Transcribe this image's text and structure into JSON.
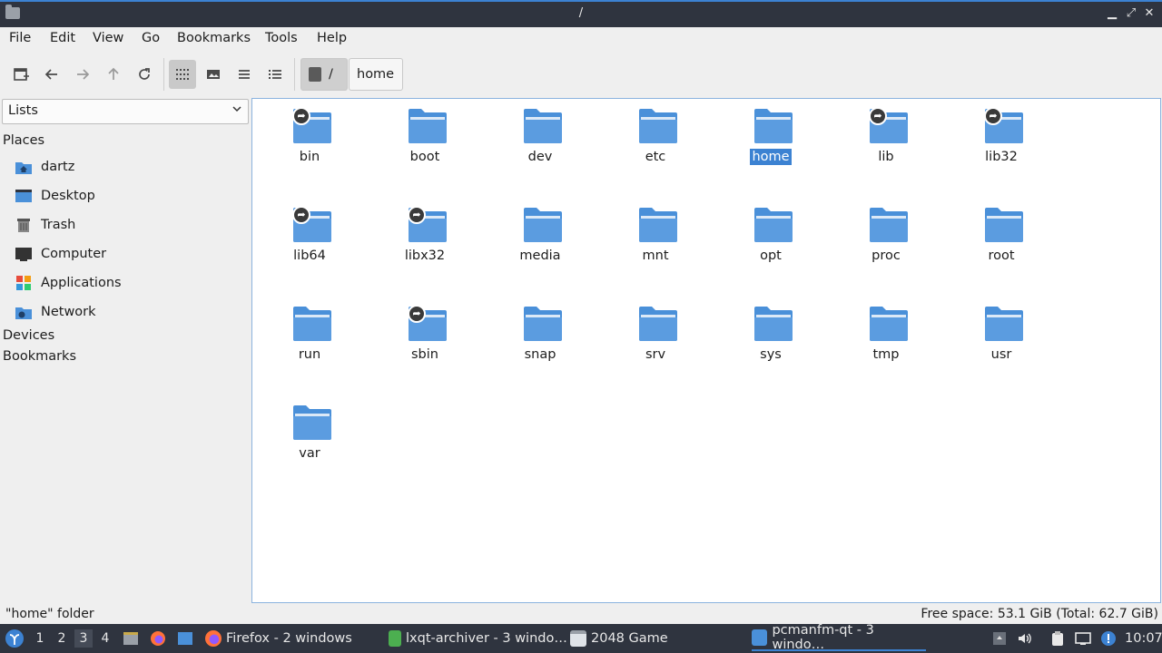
{
  "window": {
    "title": "/",
    "minimize_icon": "minimize-icon",
    "restore_icon": "restore-icon",
    "close_icon": "close-icon"
  },
  "menu": [
    "File",
    "Edit",
    "View",
    "Go",
    "Bookmarks",
    "Tools",
    "Help"
  ],
  "toolbar": {
    "buttons": [
      "new-tab-icon",
      "back-icon",
      "forward-icon",
      "up-icon",
      "reload-icon",
      "icon-view-icon",
      "thumbnail-view-icon",
      "compact-view-icon",
      "detailed-list-icon"
    ],
    "path_root": "/",
    "path_crumb": "home"
  },
  "sidebar": {
    "selector": "Lists",
    "places_heading": "Places",
    "places": [
      {
        "label": "dartz",
        "icon": "home-folder-icon"
      },
      {
        "label": "Desktop",
        "icon": "desktop-icon"
      },
      {
        "label": "Trash",
        "icon": "trash-icon"
      },
      {
        "label": "Computer",
        "icon": "computer-icon"
      },
      {
        "label": "Applications",
        "icon": "applications-icon"
      },
      {
        "label": "Network",
        "icon": "network-icon"
      }
    ],
    "devices_heading": "Devices",
    "bookmarks_heading": "Bookmarks"
  },
  "folders": [
    {
      "name": "bin",
      "link": true
    },
    {
      "name": "boot",
      "link": false
    },
    {
      "name": "dev",
      "link": false
    },
    {
      "name": "etc",
      "link": false
    },
    {
      "name": "home",
      "link": false,
      "selected": true
    },
    {
      "name": "lib",
      "link": true
    },
    {
      "name": "lib32",
      "link": true
    },
    {
      "name": "lib64",
      "link": true
    },
    {
      "name": "libx32",
      "link": true
    },
    {
      "name": "media",
      "link": false
    },
    {
      "name": "mnt",
      "link": false
    },
    {
      "name": "opt",
      "link": false
    },
    {
      "name": "proc",
      "link": false
    },
    {
      "name": "root",
      "link": false
    },
    {
      "name": "run",
      "link": false
    },
    {
      "name": "sbin",
      "link": true
    },
    {
      "name": "snap",
      "link": false
    },
    {
      "name": "srv",
      "link": false
    },
    {
      "name": "sys",
      "link": false
    },
    {
      "name": "tmp",
      "link": false
    },
    {
      "name": "usr",
      "link": false
    },
    {
      "name": "var",
      "link": false
    }
  ],
  "status": {
    "left": "\"home\" folder",
    "right": "Free space: 53.1 GiB (Total: 62.7 GiB)"
  },
  "taskbar": {
    "workspaces": [
      "1",
      "2",
      "3",
      "4"
    ],
    "active_workspace": "3",
    "tasks": [
      {
        "label": "Firefox - 2 windows",
        "icon": "firefox-icon"
      },
      {
        "label": "lxqt-archiver - 3 windo…",
        "icon": "archiver-icon"
      },
      {
        "label": "2048 Game",
        "icon": "window-icon"
      },
      {
        "label": "pcmanfm-qt - 3 windo…",
        "icon": "folder-icon"
      }
    ],
    "clock": "10:07"
  },
  "colors": {
    "accent": "#3c82d2",
    "folder": "#4a90d9",
    "titlebar": "#2f343f"
  }
}
